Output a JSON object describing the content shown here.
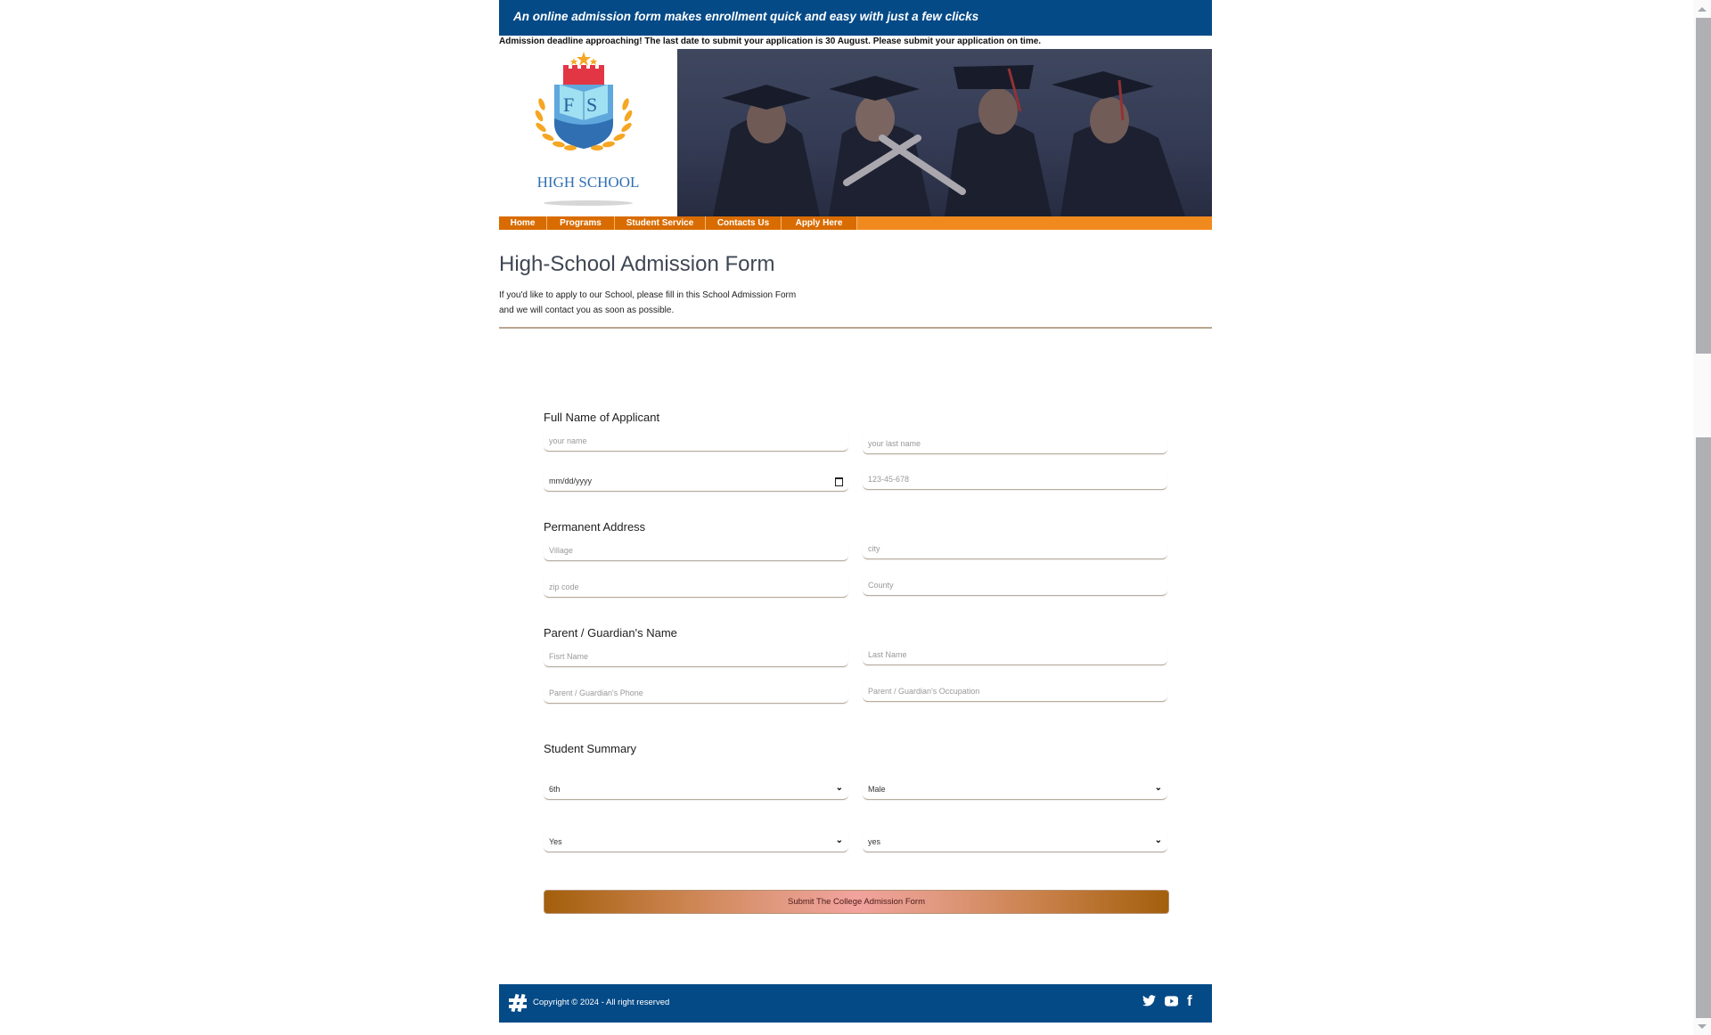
{
  "header": {
    "tagline": "An online admission form makes enrollment quick and easy with just a few clicks",
    "deadline_notice": "Admission deadline approaching! The last date to submit your application is 30 August. Please submit your application on time.",
    "logo": {
      "initials": "FS",
      "name": "HIGH SCHOOL"
    },
    "banner_alt": "Graduates in caps and gowns holding diplomas"
  },
  "nav": {
    "items": [
      {
        "label": "Home"
      },
      {
        "label": "Programs"
      },
      {
        "label": "Student Service"
      },
      {
        "label": "Contacts Us"
      },
      {
        "label": "Apply Here"
      }
    ]
  },
  "intro": {
    "title": "High-School Admission Form",
    "line1": "If you'd like to apply to our School, please fill in this School Admission Form",
    "line2": "and we will contact you as soon as possible."
  },
  "form": {
    "applicant": {
      "label": "Full Name of Applicant",
      "first_name_placeholder": "your name",
      "last_name_placeholder": "your last name",
      "dob_placeholder": "mm/dd/yyyy",
      "id_placeholder": "123-45-678"
    },
    "address": {
      "label": "Permanent Address",
      "village_placeholder": "Village",
      "city_placeholder": "city",
      "zip_placeholder": "zip code",
      "county_placeholder": "County"
    },
    "guardian": {
      "label": "Parent / Guardian's Name",
      "first_name_placeholder": "Fisrt Name",
      "last_name_placeholder": "Last Name",
      "phone_placeholder": "Parent / Guardian's Phone",
      "occupation_placeholder": "Parent / Guardian's Occupation"
    },
    "summary": {
      "label": "Student Summary",
      "grade_value": "6th",
      "gender_value": "Male",
      "select3_value": "Yes",
      "select4_value": "yes"
    },
    "submit_label": "Submit The College Admission Form"
  },
  "footer": {
    "copyright": "Copyright © 2024 - All right reserved",
    "social": [
      "twitter",
      "youtube",
      "facebook"
    ]
  },
  "colors": {
    "brand_blue": "#044a87",
    "nav_orange": "#f08a1e",
    "nav_item": "#d96c00"
  }
}
